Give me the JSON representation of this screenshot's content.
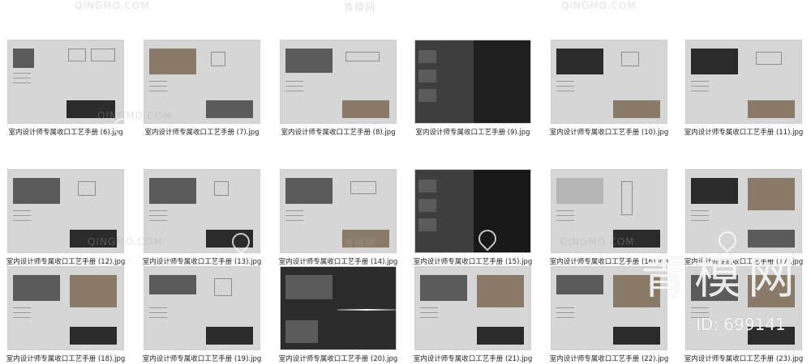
{
  "thumbnails": [
    {
      "caption": "室内设计师专属收口工艺手册 (6).jpg"
    },
    {
      "caption": "室内设计师专属收口工艺手册 (7).jpg"
    },
    {
      "caption": "室内设计师专属收口工艺手册 (8).jpg"
    },
    {
      "caption": "室内设计师专属收口工艺手册 (9).jpg"
    },
    {
      "caption": "室内设计师专属收口工艺手册 (10).jpg"
    },
    {
      "caption": "室内设计师专属收口工艺手册 (11).jpg"
    },
    {
      "caption": "室内设计师专属收口工艺手册 (12).jpg"
    },
    {
      "caption": "室内设计师专属收口工艺手册 (13).jpg"
    },
    {
      "caption": "室内设计师专属收口工艺手册 (14).jpg"
    },
    {
      "caption": "室内设计师专属收口工艺手册 (15).jpg"
    },
    {
      "caption": "室内设计师专属收口工艺手册 (16).jpg"
    },
    {
      "caption": "室内设计师专属收口工艺手册 (17).jpg"
    },
    {
      "caption": "室内设计师专属收口工艺手册 (18).jpg"
    },
    {
      "caption": "室内设计师专属收口工艺手册 (19).jpg"
    },
    {
      "caption": "室内设计师专属收口工艺手册 (20).jpg"
    },
    {
      "caption": "室内设计师专属收口工艺手册 (21).jpg"
    },
    {
      "caption": "室内设计师专属收口工艺手册 (22).jpg"
    },
    {
      "caption": "室内设计师专属收口工艺手册 (23).jpg"
    }
  ],
  "watermarks": {
    "site_cn": "青模网",
    "site_en": "QINGMO.COM",
    "brand": "青模网",
    "id": "ID: 699141"
  },
  "colors": {
    "page_bg": "#ffffff",
    "thumb_light": "#d6d6d6",
    "thumb_dark": "#3e3e3e",
    "caption_text": "#222222"
  }
}
